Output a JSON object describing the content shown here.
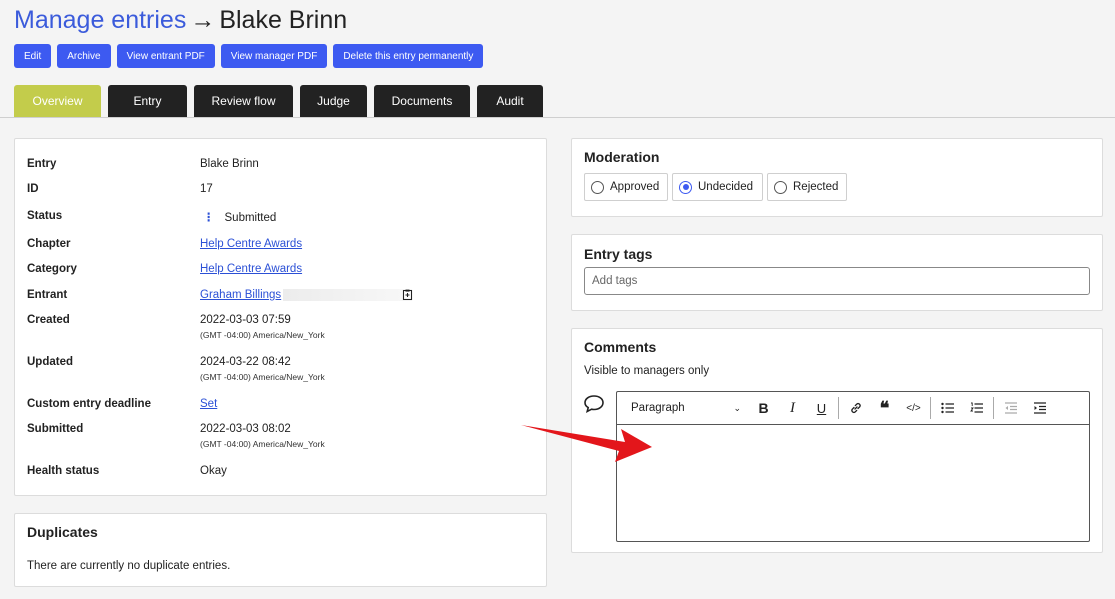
{
  "header": {
    "breadcrumb": "Manage entries",
    "arrow": "→",
    "entry_name": "Blake Brinn"
  },
  "actions": [
    "Edit",
    "Archive",
    "View entrant PDF",
    "View manager PDF",
    "Delete this entry permanently"
  ],
  "tabs": [
    {
      "label": "Overview",
      "active": true
    },
    {
      "label": "Entry",
      "active": false
    },
    {
      "label": "Review flow",
      "active": false
    },
    {
      "label": "Judge",
      "active": false
    },
    {
      "label": "Documents",
      "active": false
    },
    {
      "label": "Audit",
      "active": false
    }
  ],
  "details": {
    "entry": {
      "label": "Entry",
      "value": "Blake Brinn"
    },
    "id": {
      "label": "ID",
      "value": "17"
    },
    "status": {
      "label": "Status",
      "value": "Submitted"
    },
    "chapter": {
      "label": "Chapter",
      "value": "Help Centre Awards"
    },
    "category": {
      "label": "Category",
      "value": "Help Centre Awards"
    },
    "entrant": {
      "label": "Entrant",
      "value": "Graham Billings"
    },
    "created": {
      "label": "Created",
      "value": "2022-03-03 07:59",
      "tz": "(GMT -04:00) America/New_York"
    },
    "updated": {
      "label": "Updated",
      "value": "2024-03-22 08:42",
      "tz": "(GMT -04:00) America/New_York"
    },
    "deadline": {
      "label": "Custom entry deadline",
      "value": "Set"
    },
    "submitted": {
      "label": "Submitted",
      "value": "2022-03-03 08:02",
      "tz": "(GMT -04:00) America/New_York"
    },
    "health": {
      "label": "Health status",
      "value": "Okay"
    }
  },
  "duplicates": {
    "title": "Duplicates",
    "message": "There are currently no duplicate entries."
  },
  "moderation": {
    "title": "Moderation",
    "options": [
      "Approved",
      "Undecided",
      "Rejected"
    ],
    "selected": "Undecided"
  },
  "tags": {
    "title": "Entry tags",
    "placeholder": "Add tags"
  },
  "comments": {
    "title": "Comments",
    "subtitle": "Visible to managers only",
    "format": "Paragraph",
    "toolbar_icons": [
      "bold-icon",
      "italic-icon",
      "underline-icon",
      "link-icon",
      "quote-icon",
      "code-icon",
      "bulleted-list-icon",
      "numbered-list-icon",
      "outdent-icon",
      "indent-icon"
    ]
  },
  "colors": {
    "primary": "#3d5af1",
    "active_tab": "#c3cc4b",
    "tab": "#222222",
    "annotation_arrow": "#e3161b"
  }
}
